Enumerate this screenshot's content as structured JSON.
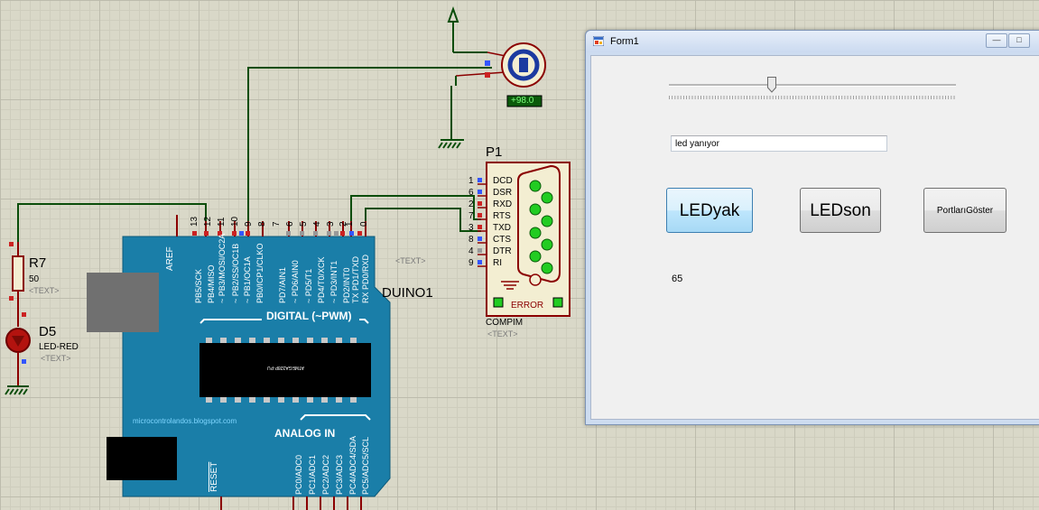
{
  "schematic": {
    "motor_readout": "+98.0",
    "serial_port": {
      "ref": "P1",
      "pin_numbers": [
        "1",
        "6",
        "2",
        "7",
        "3",
        "8",
        "4",
        "9"
      ],
      "pin_names": [
        "DCD",
        "DSR",
        "RXD",
        "RTS",
        "TXD",
        "CTS",
        "DTR",
        "RI"
      ],
      "error_label": "ERROR",
      "type_label": "COMPIM",
      "text_placeholder": "<TEXT>"
    },
    "resistor": {
      "ref": "R7",
      "value": "50",
      "text_placeholder": "<TEXT>"
    },
    "led": {
      "ref": "D5",
      "type": "LED-RED",
      "text_placeholder": "<TEXT>"
    },
    "arduino": {
      "ref": "DUINO1",
      "text_placeholder": "<TEXT>",
      "pin_numbers": [
        "13",
        "12",
        "11",
        "10",
        "9",
        "8",
        "7",
        "6",
        "5",
        "4",
        "3",
        "2",
        "1",
        "0"
      ],
      "aref_label": "AREF",
      "digital_pins": [
        "PB5/SCK",
        "PB4/MISO",
        "~ PB3/MOSI/OC2A",
        "~ PB2/SS/OC1B",
        "~ PB1/OC1A",
        "PB0/ICP1/CLKO",
        "PD7/AIN1",
        "~ PD6/AIN0",
        "~ PD5/T1",
        "PD4/T0/XCK",
        "~ PD3/INT1",
        "PD2/INT0",
        "TX PD1/TXD",
        "RX PD0/RXD"
      ],
      "digital_header": "DIGITAL (~PWM)",
      "analog_header": "ANALOG IN",
      "analog_pins": [
        "PC0/ADC0",
        "PC1/ADC1",
        "PC2/ADC2",
        "PC3/ADC3",
        "PC4/ADC4/SDA",
        "PC5/ADC5/SCL"
      ],
      "reset_label": "RESET",
      "blog_url": "microcontrolandos.blogspot.com",
      "chip_label": "ATMEGA328P-PU"
    }
  },
  "form": {
    "title": "Form1",
    "minimize_icon": "minimize-icon",
    "maximize_icon": "maximize-icon",
    "textbox_value": "led yanıyor",
    "slider_value_fraction": 0.36,
    "buttons": {
      "ledyak": "LEDyak",
      "ledson": "LEDson",
      "ports": "PortlarıGöster"
    },
    "value_label": "65"
  }
}
